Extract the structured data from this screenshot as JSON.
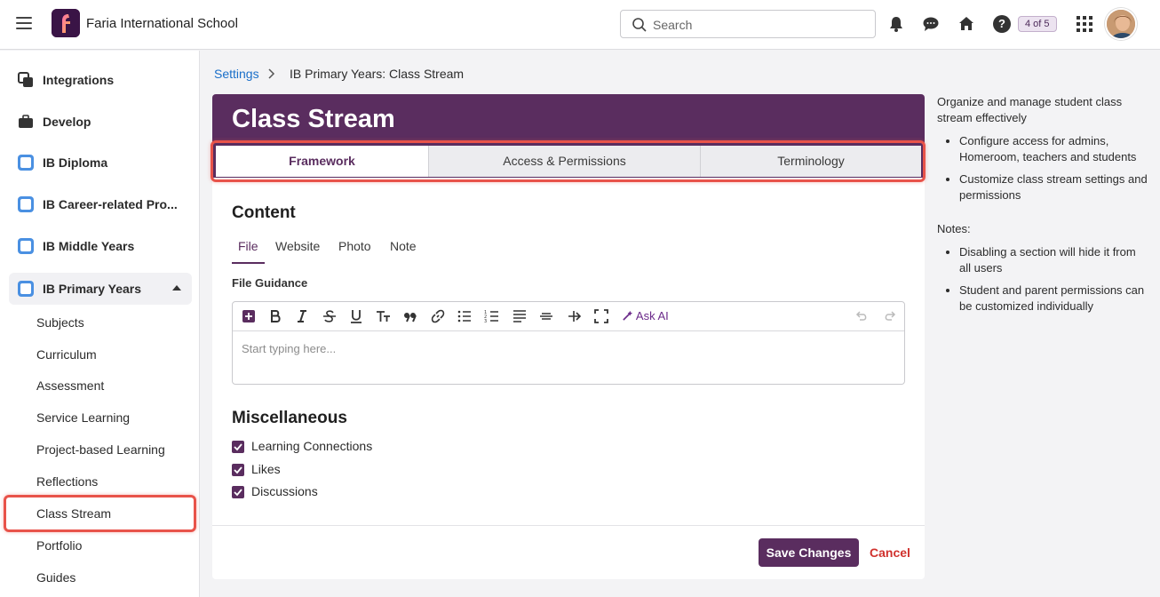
{
  "header": {
    "app_title": "Faria International School",
    "search_placeholder": "Search",
    "badge": "4 of 5",
    "help": "?"
  },
  "sidebar": {
    "items": [
      {
        "label": "Integrations",
        "icon": "integrations-icon"
      },
      {
        "label": "Develop",
        "icon": "briefcase-icon"
      },
      {
        "label": "IB Diploma",
        "icon": "ib-diploma-icon"
      },
      {
        "label": "IB Career-related Pro...",
        "icon": "ib-career-icon"
      },
      {
        "label": "IB Middle Years",
        "icon": "ib-middle-years-icon"
      },
      {
        "label": "IB Primary Years",
        "icon": "ib-primary-years-icon"
      }
    ],
    "sub_items": [
      "Subjects",
      "Curriculum",
      "Assessment",
      "Service Learning",
      "Project-based Learning",
      "Reflections",
      "Class Stream",
      "Portfolio",
      "Guides"
    ],
    "selected": "Class Stream"
  },
  "breadcrumb": {
    "link": "Settings",
    "separator": ">",
    "current": "IB Primary Years: Class Stream"
  },
  "page": {
    "title": "Class Stream",
    "tabs": [
      "Framework",
      "Access & Permissions",
      "Terminology"
    ],
    "active_tab": "Framework"
  },
  "content": {
    "title": "Content",
    "subtabs": [
      "File",
      "Website",
      "Photo",
      "Note"
    ],
    "active_subtab": "File",
    "field_label": "File Guidance",
    "editor_placeholder": "Start typing here...",
    "ask_ai": "Ask AI"
  },
  "misc": {
    "title": "Miscellaneous",
    "options": [
      {
        "label": "Learning Connections",
        "checked": true
      },
      {
        "label": "Likes",
        "checked": true
      },
      {
        "label": "Discussions",
        "checked": true
      }
    ]
  },
  "footer": {
    "save": "Save Changes",
    "cancel": "Cancel"
  },
  "info": {
    "intro": "Organize and manage student class stream effectively",
    "bullets": [
      "Configure access for admins, Homeroom, teachers and students",
      "Customize class stream settings and permissions"
    ],
    "notes_title": "Notes:",
    "notes": [
      "Disabling a section will hide it from all users",
      "Student and parent permissions can be customized individually"
    ]
  },
  "colors": {
    "brand": "#5a2d5f",
    "link": "#1a6fc9",
    "cancel": "#d0312d",
    "highlight": "#e8534a"
  }
}
